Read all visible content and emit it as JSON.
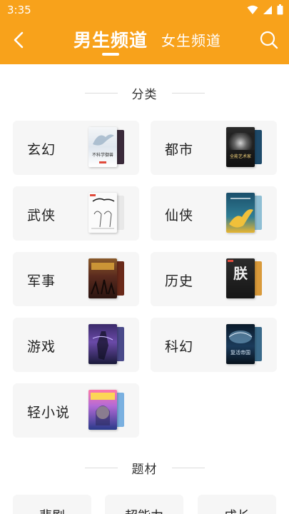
{
  "status_bar": {
    "time": "3:35"
  },
  "header": {
    "tab_male": "男生频道",
    "tab_female": "女生频道",
    "bg_color": "#f8a21b"
  },
  "sections": {
    "category_title": "分类",
    "theme_title": "题材"
  },
  "categories": [
    {
      "label": "玄幻",
      "cover_title": "不科学御兽"
    },
    {
      "label": "都市",
      "cover_title": "全能艺术家"
    },
    {
      "label": "武侠",
      "cover_title": ""
    },
    {
      "label": "仙侠",
      "cover_title": ""
    },
    {
      "label": "军事",
      "cover_title": ""
    },
    {
      "label": "历史",
      "cover_title": "朕"
    },
    {
      "label": "游戏",
      "cover_title": ""
    },
    {
      "label": "科幻",
      "cover_title": "复活帝国"
    },
    {
      "label": "轻小说",
      "cover_title": ""
    }
  ],
  "themes": [
    {
      "label": "悲剧"
    },
    {
      "label": "超能力"
    },
    {
      "label": "成长"
    }
  ]
}
